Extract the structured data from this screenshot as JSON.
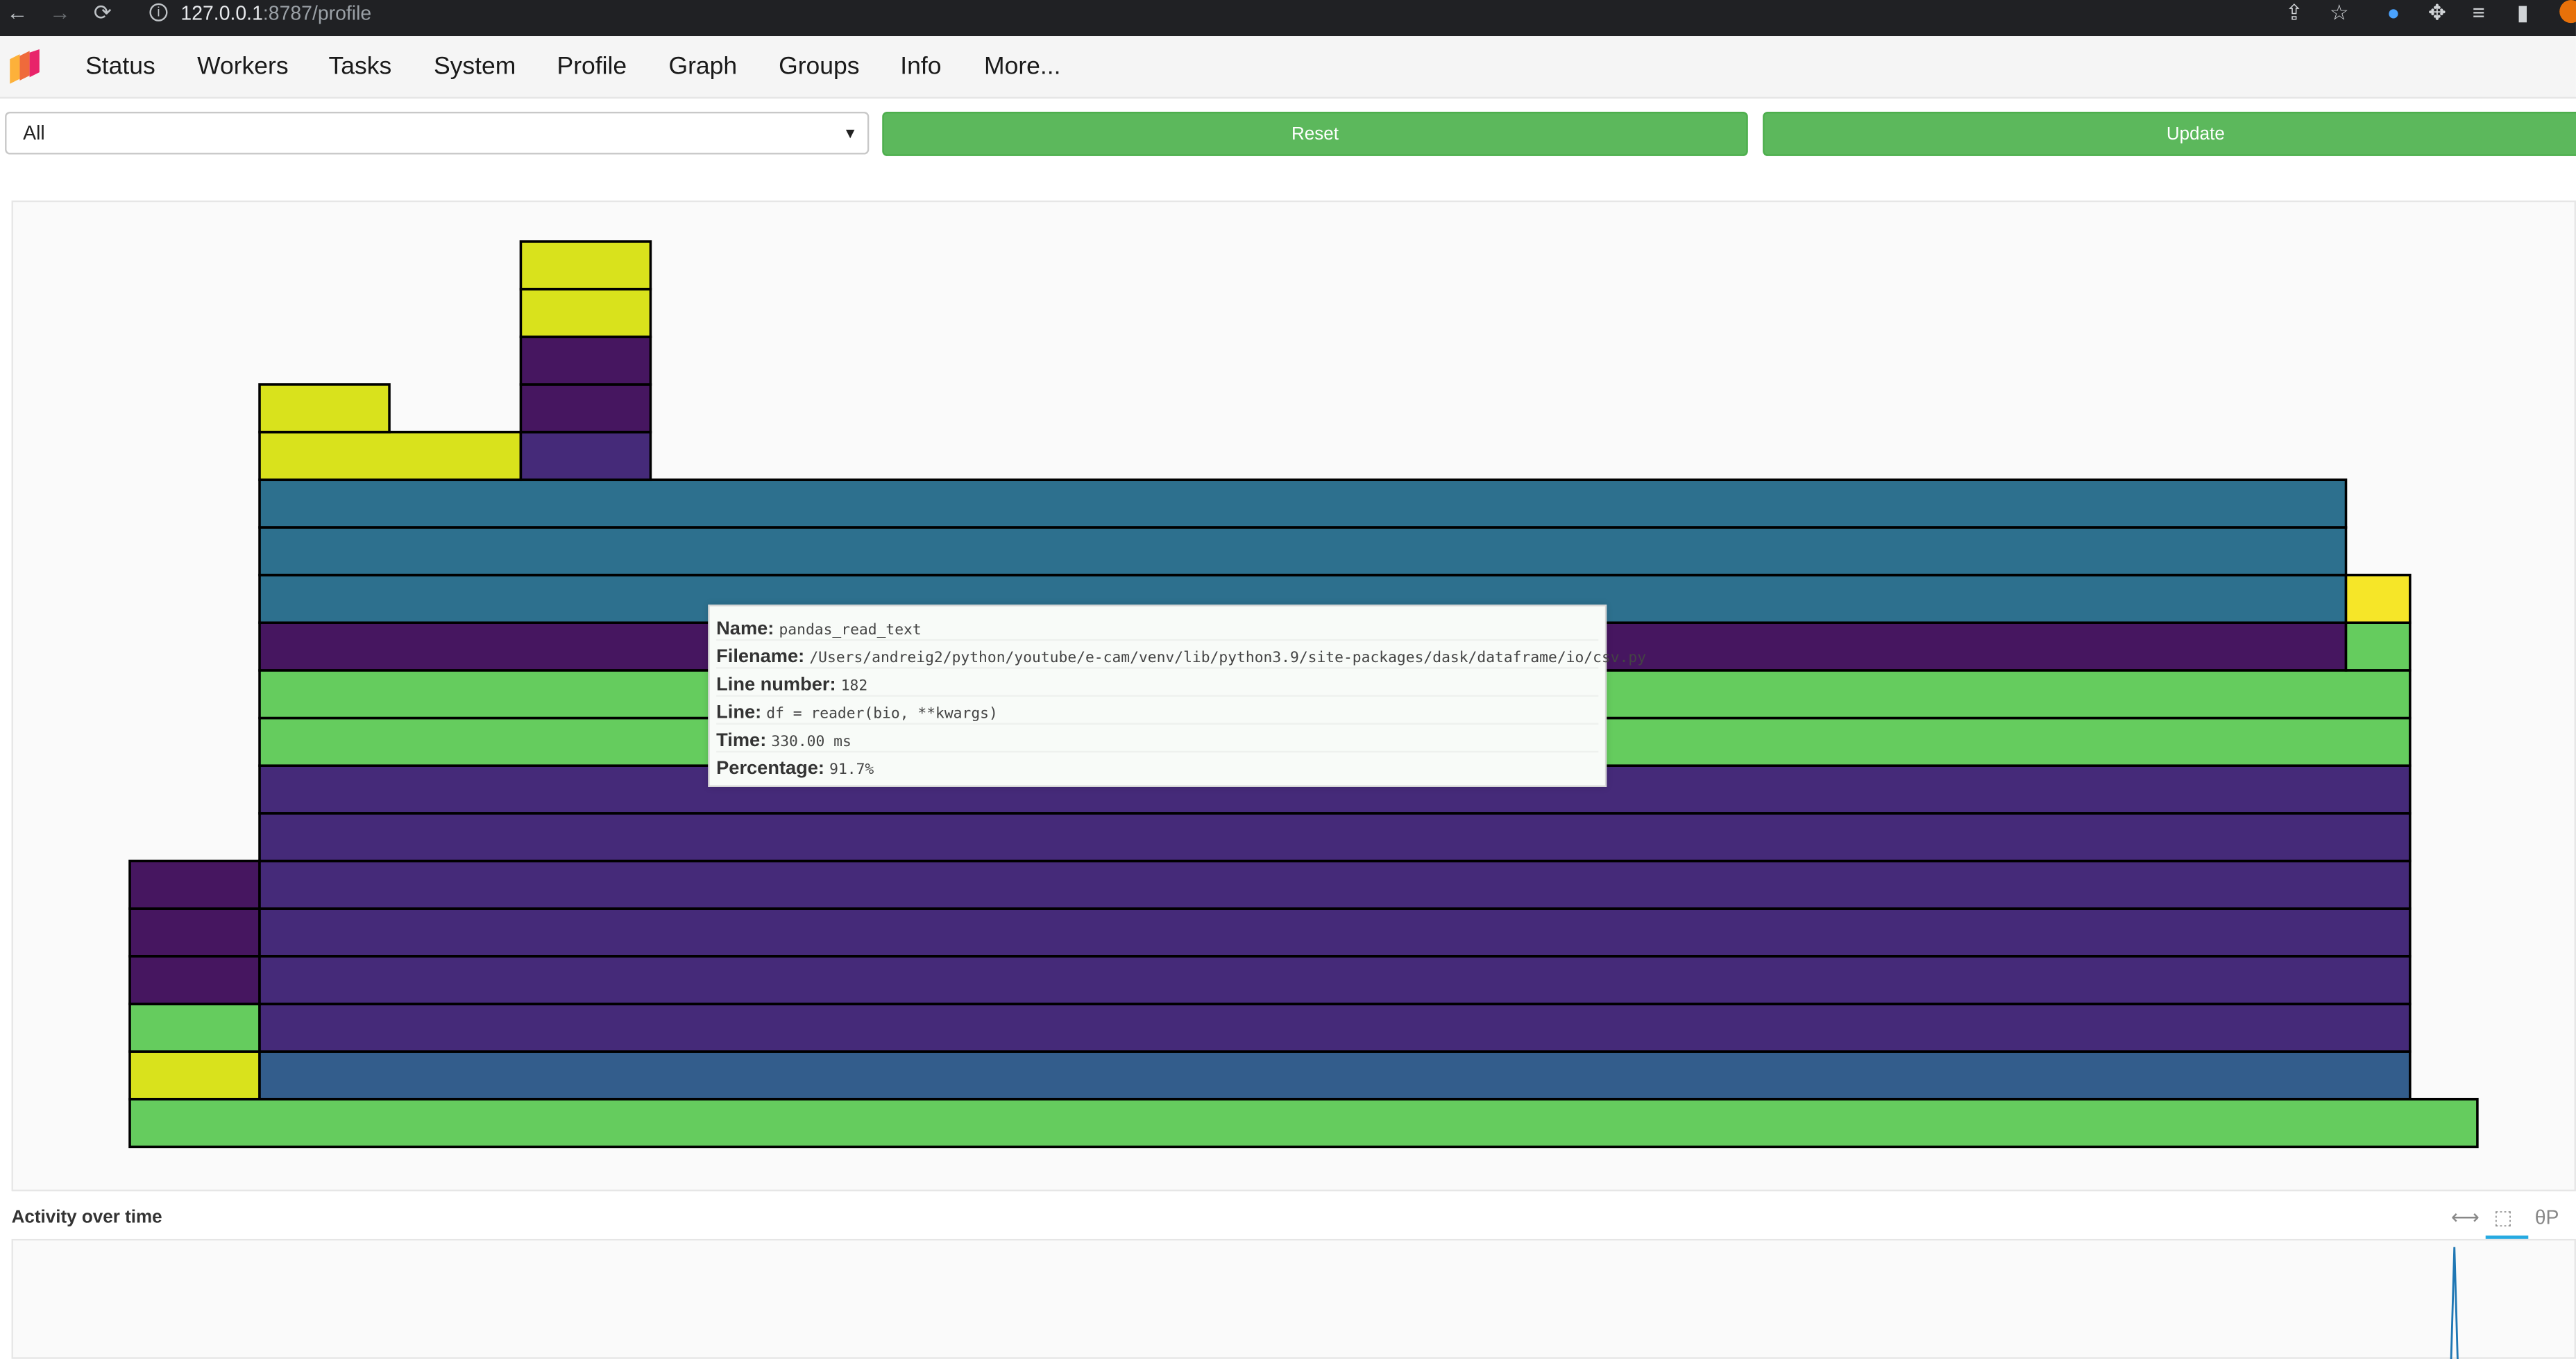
{
  "browser": {
    "url_host": "127.0.0.1",
    "url_path": ":8787/profile"
  },
  "nav": {
    "items": [
      "Status",
      "Workers",
      "Tasks",
      "System",
      "Profile",
      "Graph",
      "Groups",
      "Info",
      "More..."
    ]
  },
  "controls": {
    "select_value": "All",
    "reset_label": "Reset",
    "update_label": "Update"
  },
  "colors": {
    "button_green": "#5cb85c",
    "lime": "#d9e21c",
    "yellow": "#f6e628",
    "dark_purple": "#461660",
    "purple": "#452a79",
    "blue": "#2d708e",
    "steel_blue": "#335d8c",
    "green": "#65cc5e"
  },
  "tooltip": {
    "name_label": "Name:",
    "name_value": "pandas_read_text",
    "filename_label": "Filename:",
    "filename_value": "/Users/andreig2/python/youtube/e-cam/venv/lib/python3.9/site-packages/dask/dataframe/io/csv.py",
    "line_number_label": "Line number:",
    "line_number_value": "182",
    "line_label": "Line:",
    "line_value": "df = reader(bio, **kwargs)",
    "time_label": "Time:",
    "time_value": "330.00 ms",
    "percentage_label": "Percentage:",
    "percentage_value": "91.7%"
  },
  "activity": {
    "title": "Activity over time"
  },
  "toolbar_icons": [
    "pan-icon",
    "box-zoom-icon",
    "bokeh-logo-icon"
  ]
}
